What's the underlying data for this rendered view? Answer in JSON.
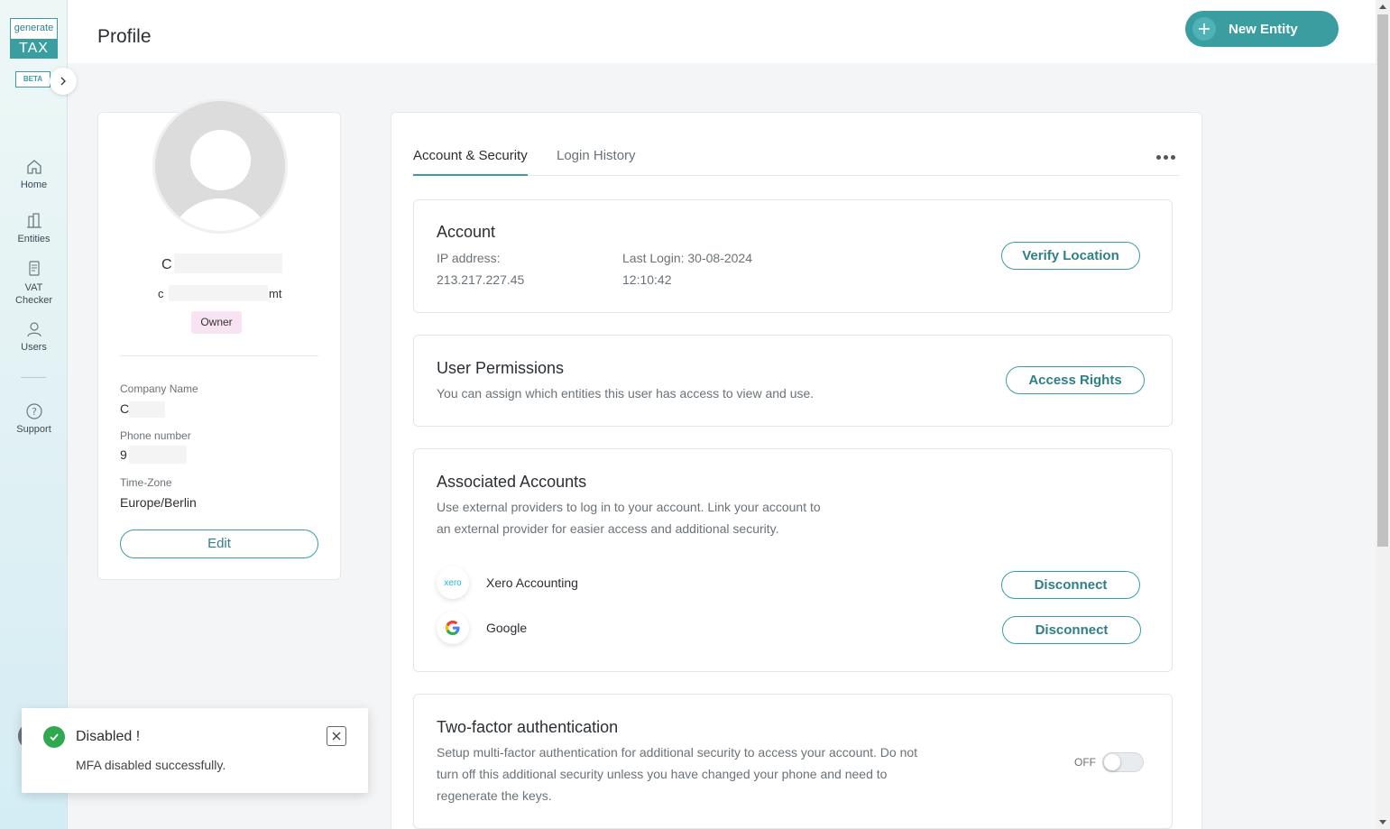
{
  "brand": {
    "logo_top": "generate",
    "logo_bottom": "TAX",
    "beta": "BETA"
  },
  "sidebar": {
    "items": [
      {
        "label": "Home",
        "icon": "home-icon"
      },
      {
        "label": "Entities",
        "icon": "building-icon"
      },
      {
        "label": "VAT Checker",
        "line1": "VAT",
        "line2": "Checker",
        "icon": "document-icon"
      },
      {
        "label": "Users",
        "icon": "user-icon"
      },
      {
        "label": "Support",
        "icon": "help-icon"
      }
    ]
  },
  "header": {
    "title": "Profile",
    "new_entity_label": "New Entity"
  },
  "profile": {
    "name_initial": "C",
    "email_start": "c",
    "email_end": "mt",
    "role": "Owner",
    "company_label": "Company Name",
    "company_value": "C",
    "phone_label": "Phone number",
    "phone_value": "9",
    "timezone_label": "Time-Zone",
    "timezone_value": "Europe/Berlin",
    "edit_label": "Edit"
  },
  "tabs": [
    {
      "label": "Account & Security",
      "active": true
    },
    {
      "label": "Login History",
      "active": false
    }
  ],
  "account": {
    "title": "Account",
    "ip_label": "IP address:",
    "ip_value": "213.217.227.45",
    "last_login_label": "Last Login: 30-08-2024",
    "last_login_time": "12:10:42",
    "verify_label": "Verify Location"
  },
  "permissions": {
    "title": "User Permissions",
    "text": "You can assign which entities this user has access to view and use.",
    "button_label": "Access Rights"
  },
  "associated": {
    "title": "Associated Accounts",
    "text_line1": "Use external providers to log in to your account. Link your account to",
    "text_line2": "an external provider for easier access and additional security.",
    "providers": [
      {
        "name": "Xero Accounting",
        "icon_text": "xero",
        "button": "Disconnect"
      },
      {
        "name": "Google",
        "icon_text": "G",
        "button": "Disconnect"
      }
    ]
  },
  "two_factor": {
    "title": "Two-factor authentication",
    "text_line1": "Setup multi-factor authentication for additional security to access your account. Do not",
    "text_line2": "turn off this additional security unless you have changed your phone and need to",
    "text_line3": "regenerate the keys.",
    "toggle_label": "OFF",
    "enabled": false
  },
  "toast": {
    "title": "Disabled !",
    "message": "MFA disabled successfully."
  },
  "colors": {
    "accent": "#3a9ea0",
    "success": "#2fa84f",
    "badge": "#f8e3f3"
  }
}
